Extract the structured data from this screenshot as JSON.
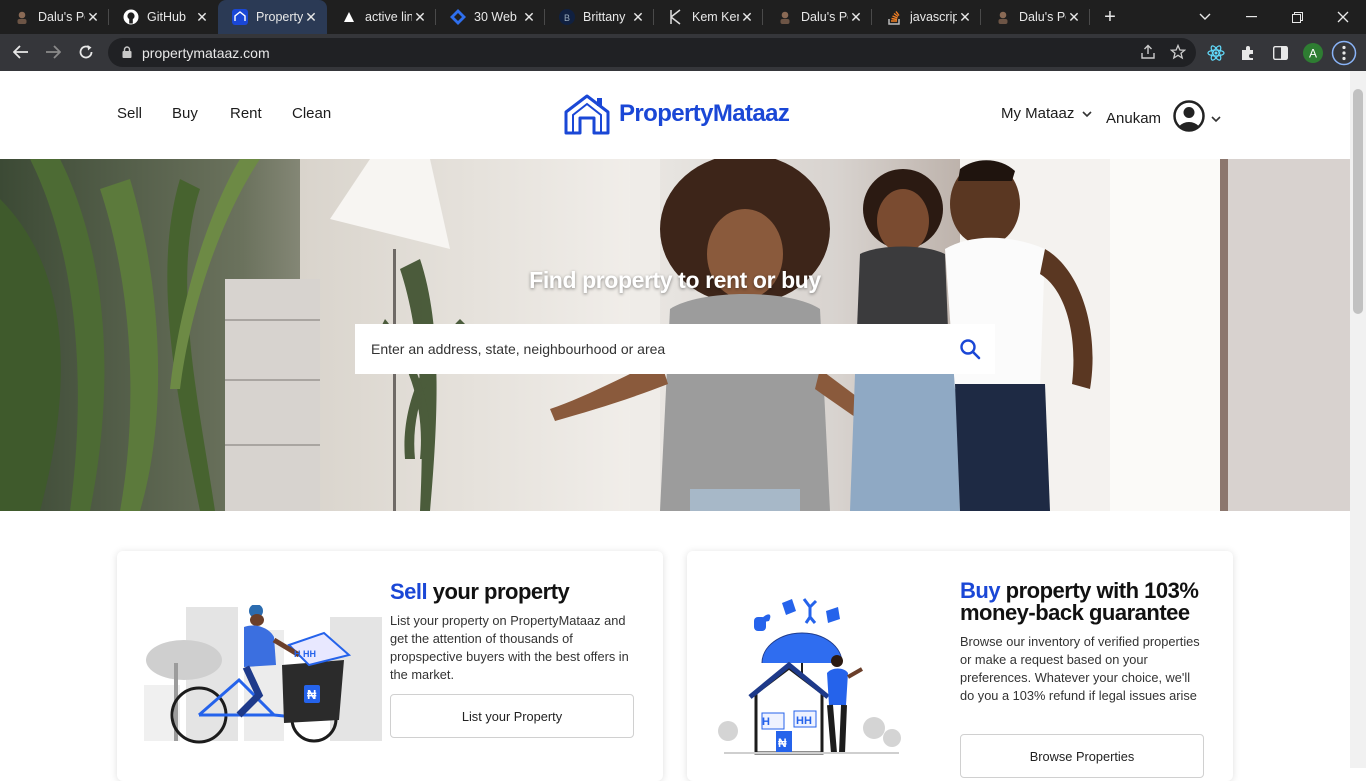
{
  "browser": {
    "tabs": [
      {
        "title": "Dalu's Pc",
        "icon": "avatar-icon"
      },
      {
        "title": "GitHub",
        "icon": "github-icon"
      },
      {
        "title": "Property",
        "icon": "propertymataaz-icon",
        "active": true
      },
      {
        "title": "active lin",
        "icon": "triangle-icon"
      },
      {
        "title": "30 Web",
        "icon": "diamond-icon"
      },
      {
        "title": "Brittany",
        "icon": "b-icon"
      },
      {
        "title": "Kem Ken",
        "icon": "k-icon"
      },
      {
        "title": "Dalu's Pc",
        "icon": "avatar-icon"
      },
      {
        "title": "javascrip",
        "icon": "stackoverflow-icon"
      },
      {
        "title": "Dalu's Pc",
        "icon": "avatar-icon"
      }
    ],
    "url": "propertymataaz.com",
    "profile_initial": "A"
  },
  "header": {
    "nav": [
      "Sell",
      "Buy",
      "Rent",
      "Clean"
    ],
    "logo": "PropertyMataaz",
    "my_mataaz": "My Mataaz",
    "username": "Anukam"
  },
  "hero": {
    "title": "Find property to rent or buy",
    "search_placeholder": "Enter an address, state, neighbourhood or area"
  },
  "sell_card": {
    "title_accent": "Sell",
    "title_rest": " your property",
    "body": "List your property on PropertyMataaz and get the attention of thousands of propspective buyers with the best offers in the market.",
    "button": "List your Property"
  },
  "buy_card": {
    "title_accent": "Buy",
    "title_rest": " property with 103% money-back guarantee",
    "body": "Browse our inventory of verified properties or make a request based on your preferences. Whatever your choice, we'll do you a 103% refund if legal issues arise",
    "button": "Browse Properties"
  },
  "colors": {
    "brand": "#1a47d6",
    "tabbar": "#1f1f1f",
    "toolbar": "#35363a"
  }
}
